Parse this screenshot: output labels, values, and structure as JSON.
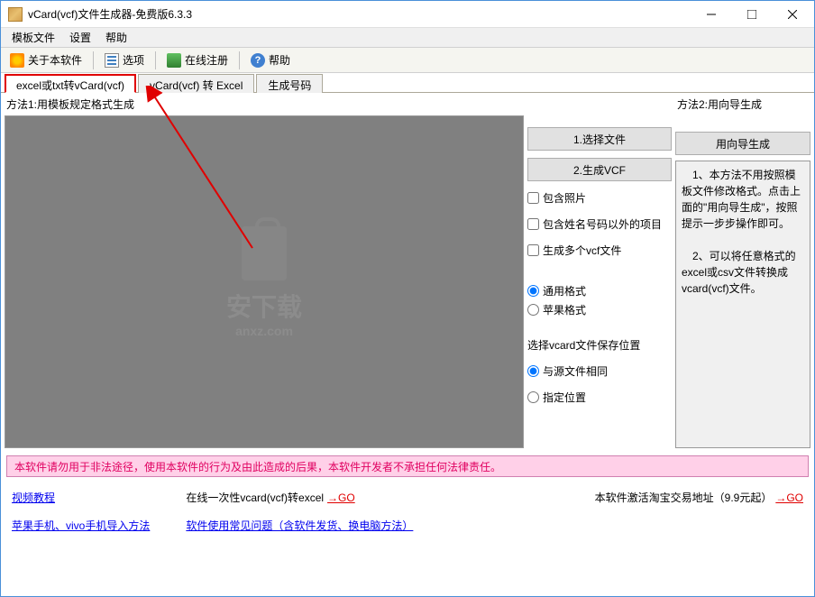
{
  "window": {
    "title": "vCard(vcf)文件生成器-免费版6.3.3"
  },
  "menubar": {
    "template": "模板文件",
    "settings": "设置",
    "help": "帮助"
  },
  "toolbar": {
    "about": "关于本软件",
    "options": "选项",
    "register": "在线注册",
    "help": "帮助"
  },
  "tabs": {
    "tab1": "excel或txt转vCard(vcf)",
    "tab2": "vCard(vcf) 转 Excel",
    "tab3": "生成号码"
  },
  "method1": {
    "label": "方法1:用模板规定格式生成",
    "watermark": "安下载",
    "watermark_sub": "anxz.com"
  },
  "actions": {
    "select_file": "1.选择文件",
    "generate_vcf": "2.生成VCF",
    "include_photo": "包含照片",
    "include_other": "包含姓名号码以外的项目",
    "multi_vcf": "生成多个vcf文件",
    "format_general": "通用格式",
    "format_apple": "苹果格式",
    "save_location_label": "选择vcard文件保存位置",
    "same_as_source": "与源文件相同",
    "specified_location": "指定位置"
  },
  "method2": {
    "label": "方法2:用向导生成",
    "wizard_btn": "用向导生成",
    "desc": "　1、本方法不用按照模板文件修改格式。点击上面的\"用向导生成\"，按照提示一步步操作即可。\n\n　2、可以将任意格式的excel或csv文件转换成vcard(vcf)文件。"
  },
  "warning": "本软件请勿用于非法途径，使用本软件的行为及由此造成的后果，本软件开发者不承担任何法律责任。",
  "links": {
    "video_tutorial": "视频教程",
    "import_guide": "苹果手机、vivo手机导入方法",
    "online_convert_label": "在线一次性vcard(vcf)转excel",
    "faq": "软件使用常见问题（含软件发货、换电脑方法）",
    "taobao_label": "本软件激活淘宝交易地址（9.9元起）",
    "go": "→GO"
  }
}
